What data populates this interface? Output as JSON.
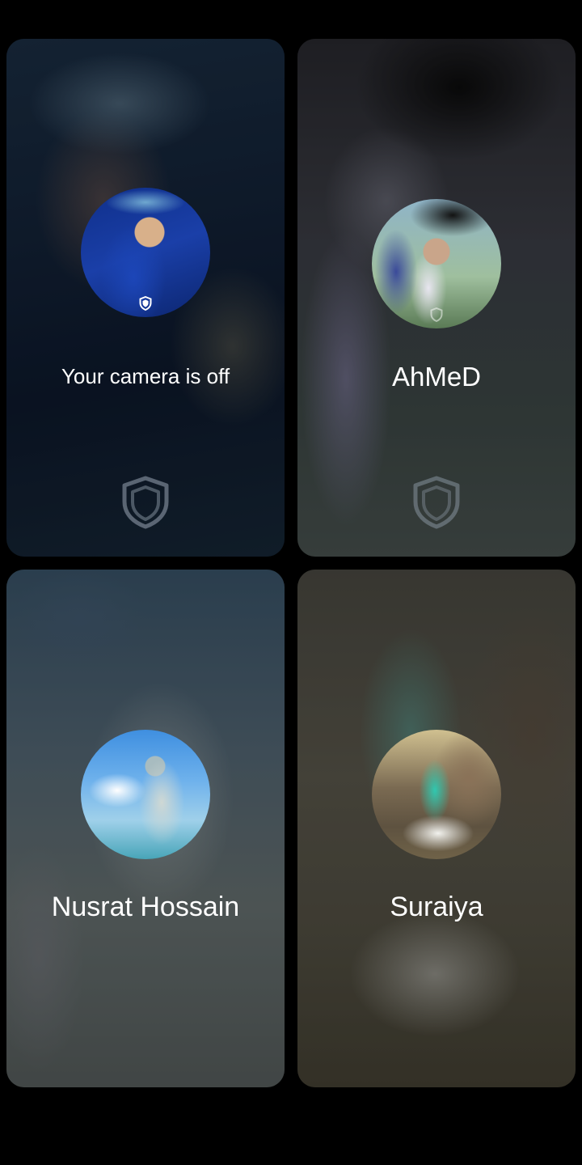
{
  "participants": [
    {
      "name": "Your camera is off",
      "avatar_icon": "user-avatar",
      "protected_icon": "shield-icon",
      "show_shield": true
    },
    {
      "name": "AhMeD",
      "avatar_icon": "user-avatar",
      "protected_icon": "shield-icon",
      "show_shield": true
    },
    {
      "name": "Nusrat Hossain",
      "avatar_icon": "user-avatar",
      "show_shield": false
    },
    {
      "name": "Suraiya",
      "avatar_icon": "user-avatar",
      "show_shield": false
    }
  ],
  "colors": {
    "background": "#000000",
    "text": "#ffffff",
    "shield": "#9aa6b4"
  }
}
